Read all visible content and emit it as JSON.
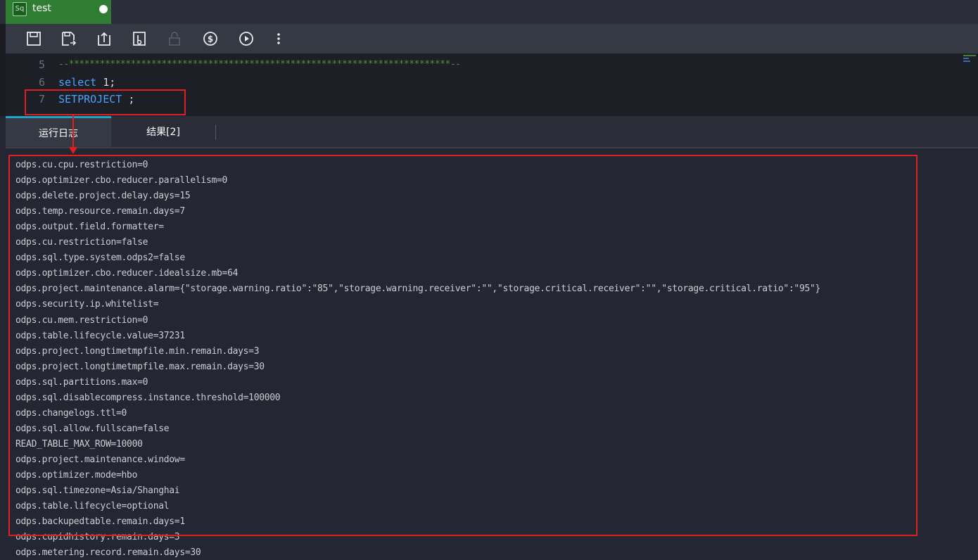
{
  "tab": {
    "icon_text": "Sq",
    "title": "test"
  },
  "toolbar": {
    "buttons": [
      {
        "name": "save-icon"
      },
      {
        "name": "save-as-icon"
      },
      {
        "name": "submit-icon"
      },
      {
        "name": "publish-icon"
      },
      {
        "name": "lock-icon"
      },
      {
        "name": "cost-estimate-icon"
      },
      {
        "name": "run-icon"
      },
      {
        "name": "more-icon"
      }
    ]
  },
  "editor": {
    "lines": [
      {
        "number": "5",
        "text": "--**************************************************************************--"
      },
      {
        "number": "6",
        "keyword": "select",
        "rest": " 1;"
      },
      {
        "number": "7",
        "keyword": "SETPROJECT",
        "rest": " ;"
      }
    ]
  },
  "result_tabs": [
    {
      "label": "运行日志",
      "active": true
    },
    {
      "label": "结果[2]",
      "active": false
    }
  ],
  "log_lines": [
    "odps.cu.cpu.restriction=0",
    "odps.optimizer.cbo.reducer.parallelism=0",
    "odps.delete.project.delay.days=15",
    "odps.temp.resource.remain.days=7",
    "odps.output.field.formatter=",
    "odps.cu.restriction=false",
    "odps.sql.type.system.odps2=false",
    "odps.optimizer.cbo.reducer.idealsize.mb=64",
    "odps.project.maintenance.alarm={\"storage.warning.ratio\":\"85\",\"storage.warning.receiver\":\"\",\"storage.critical.receiver\":\"\",\"storage.critical.ratio\":\"95\"}",
    "odps.security.ip.whitelist=",
    "odps.cu.mem.restriction=0",
    "odps.table.lifecycle.value=37231",
    "odps.project.longtimetmpfile.min.remain.days=3",
    "odps.project.longtimetmpfile.max.remain.days=30",
    "odps.sql.partitions.max=0",
    "odps.sql.disablecompress.instance.threshold=100000",
    "odps.changelogs.ttl=0",
    "odps.sql.allow.fullscan=false",
    "READ_TABLE_MAX_ROW=10000",
    "odps.project.maintenance.window=",
    "odps.optimizer.mode=hbo",
    "odps.sql.timezone=Asia/Shanghai",
    "odps.table.lifecycle=optional",
    "odps.backupedtable.remain.days=1",
    "odps.cupidhistory.remain.days=3",
    "odps.metering.record.remain.days=30"
  ],
  "colors": {
    "highlight": "#e02020",
    "tab_active": "#2e7d32",
    "keyword": "#4ea1ff",
    "comment": "#5d8b3a"
  }
}
